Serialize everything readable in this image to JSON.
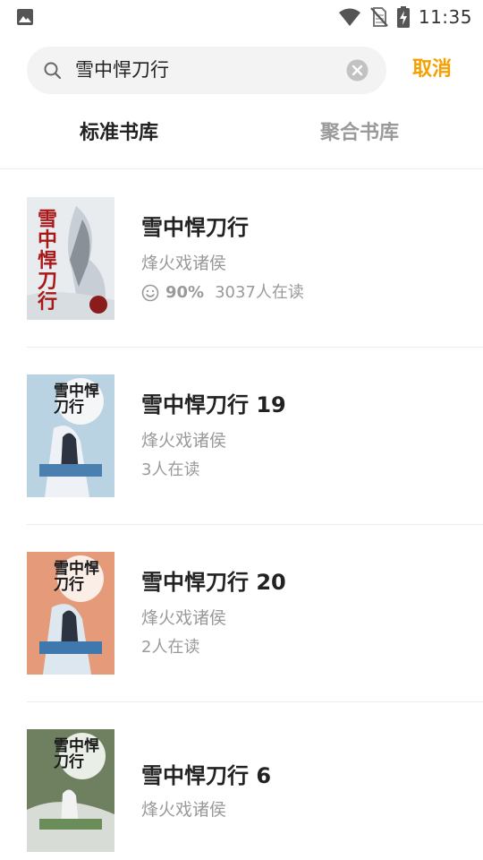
{
  "status_bar": {
    "time": "11:35",
    "icons": [
      "gallery-icon",
      "wifi-icon",
      "no-sim-icon",
      "battery-charging-icon"
    ]
  },
  "search": {
    "query": "雪中悍刀行",
    "cancel_label": "取消",
    "icons": [
      "search-icon",
      "clear-icon"
    ]
  },
  "tabs": [
    {
      "label": "标准书库",
      "active": true
    },
    {
      "label": "聚合书库",
      "active": false
    }
  ],
  "books": [
    {
      "title": "雪中悍刀行",
      "author": "烽火戏诸侯",
      "rating": "90%",
      "readers": "3037人在读",
      "cover_text": "雪中悍刀行",
      "cover_bg": "#e9ecef"
    },
    {
      "title": "雪中悍刀行 19",
      "author": "烽火戏诸侯",
      "readers": "3人在读",
      "cover_text": "雪中悍刀行",
      "cover_bg": "#b9d3e3"
    },
    {
      "title": "雪中悍刀行 20",
      "author": "烽火戏诸侯",
      "readers": "2人在读",
      "cover_text": "雪中悍刀行",
      "cover_bg": "#e59a7a"
    },
    {
      "title": "雪中悍刀行 6",
      "author": "烽火戏诸侯",
      "cover_text": "雪中悍刀行",
      "cover_bg": "#6f8060"
    }
  ],
  "colors": {
    "accent": "#f5a000",
    "muted_text": "#9a9a9a",
    "primary_text": "#222222"
  }
}
